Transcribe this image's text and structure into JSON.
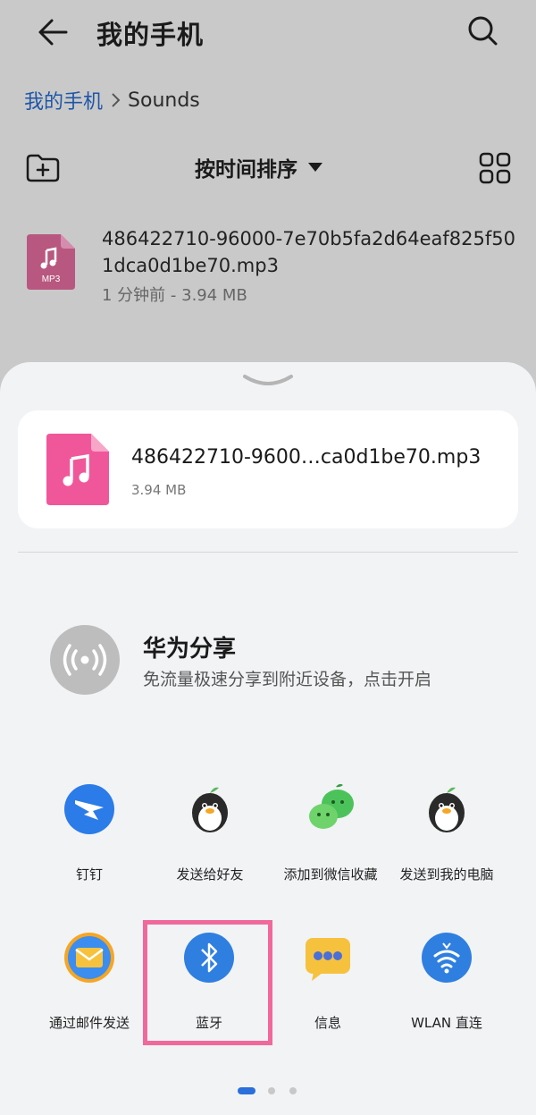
{
  "header": {
    "title": "我的手机"
  },
  "breadcrumb": {
    "root": "我的手机",
    "current": "Sounds"
  },
  "toolbar": {
    "sort_label": "按时间排序"
  },
  "file": {
    "name": "486422710-96000-7e70b5fa2d64eaf825f501dca0d1be70.mp3",
    "meta": "1 分钟前 - 3.94 MB",
    "icon_badge": "MP3"
  },
  "share_sheet": {
    "card_name": "486422710-9600…ca0d1be70.mp3",
    "card_size": "3.94 MB",
    "huawei_share": {
      "title": "华为分享",
      "description": "免流量极速分享到附近设备，点击开启"
    },
    "apps": [
      {
        "label": "钉钉",
        "icon": "dingtalk-icon"
      },
      {
        "label": "发送给好友",
        "icon": "penguin-icon"
      },
      {
        "label": "添加到微信收藏",
        "icon": "wechat-favorites-icon"
      },
      {
        "label": "发送到我的电脑",
        "icon": "penguin-icon"
      },
      {
        "label": "通过邮件发送",
        "icon": "mail-icon"
      },
      {
        "label": "蓝牙",
        "icon": "bluetooth-icon"
      },
      {
        "label": "信息",
        "icon": "message-icon"
      },
      {
        "label": "WLAN 直连",
        "icon": "wlan-direct-icon"
      }
    ],
    "pager": {
      "pages": 3,
      "current": 1
    }
  },
  "colors": {
    "accent_blue": "#1e56a8",
    "file_pink": "#f0579a",
    "highlight": "#f0699a"
  }
}
